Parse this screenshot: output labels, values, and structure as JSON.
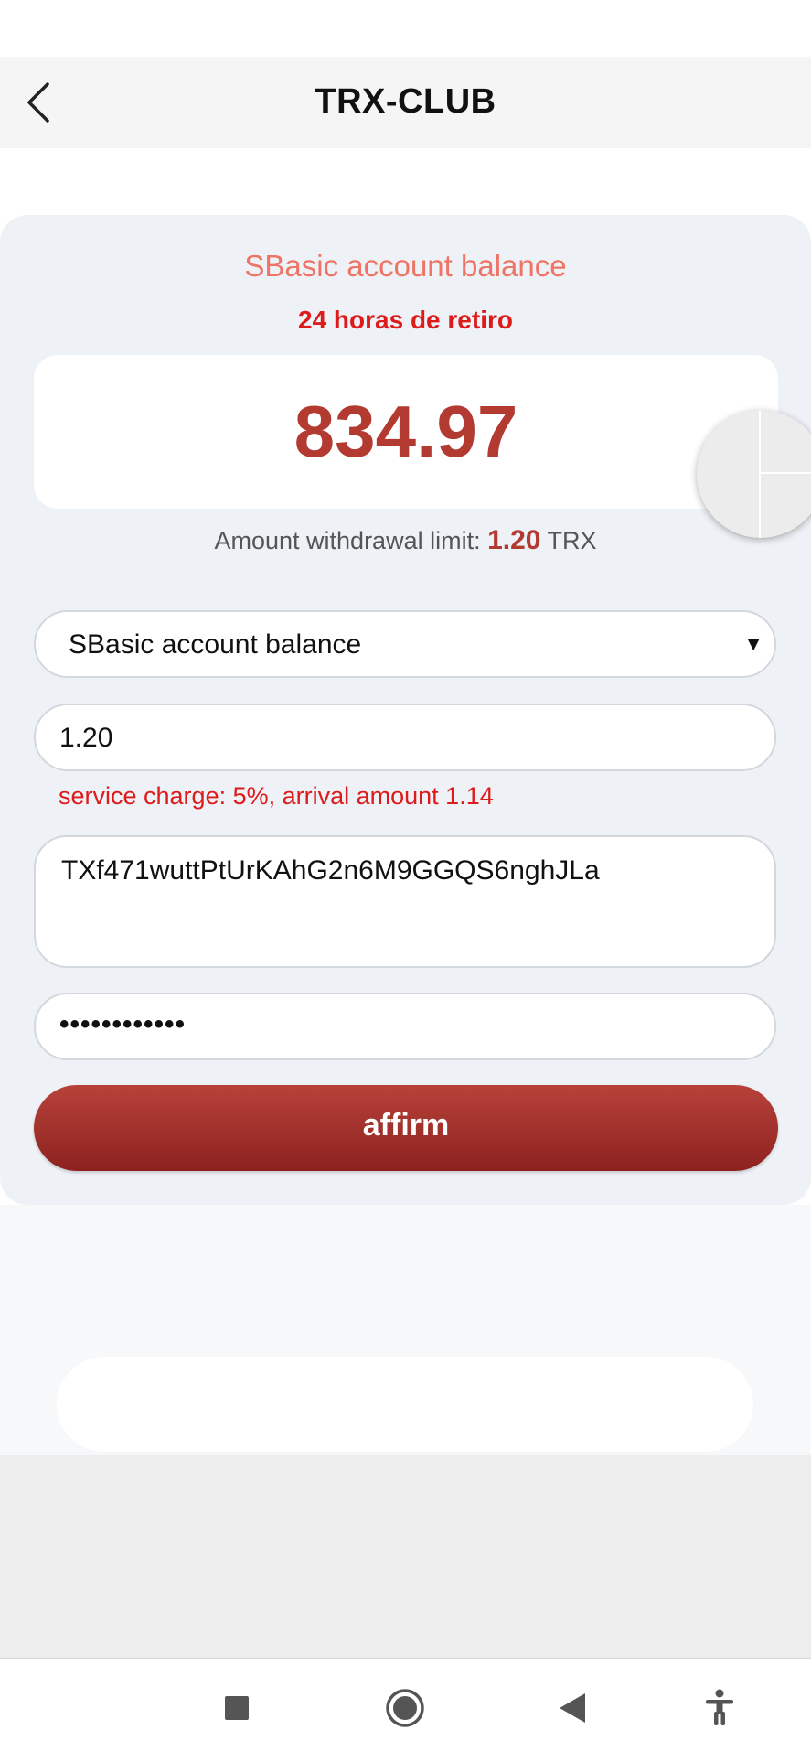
{
  "header": {
    "title": "TRX-CLUB"
  },
  "card": {
    "title": "SBasic account balance",
    "subtitle": "24 horas de retiro",
    "balance": "834.97",
    "limit_label": "Amount withdrawal limit:",
    "limit_value": "1.20",
    "limit_unit": "TRX"
  },
  "form": {
    "account_select": "SBasic account balance",
    "amount": "1.20",
    "charge_note": "service charge: 5%, arrival amount 1.14",
    "address": "TXf471wuttPtUrKAhG2n6M9GGQS6nghJLa",
    "password_mask": "••••••••••••",
    "submit_label": "affirm"
  },
  "nav_bar": {
    "items": [
      "stop-icon",
      "home-circle-icon",
      "back-triangle-icon",
      "accessibility-icon"
    ]
  },
  "colors": {
    "accent": "#b23a30",
    "title_salmon": "#ee7465",
    "warning_red": "#dd1b1b",
    "card_bg": "#eef1f6"
  }
}
